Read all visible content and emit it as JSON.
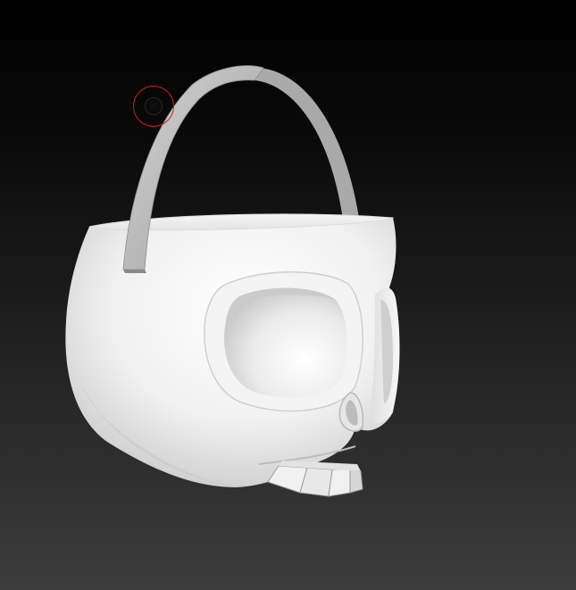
{
  "viewport": {
    "background_top": "#000000",
    "background_bottom": "#3c3c3c"
  },
  "model": {
    "material_color": "#f2f2f2",
    "shadow_color": "#9a9a9a",
    "handle_color": "#b9b9b9"
  },
  "brush": {
    "ring_color": "#c8201e"
  }
}
